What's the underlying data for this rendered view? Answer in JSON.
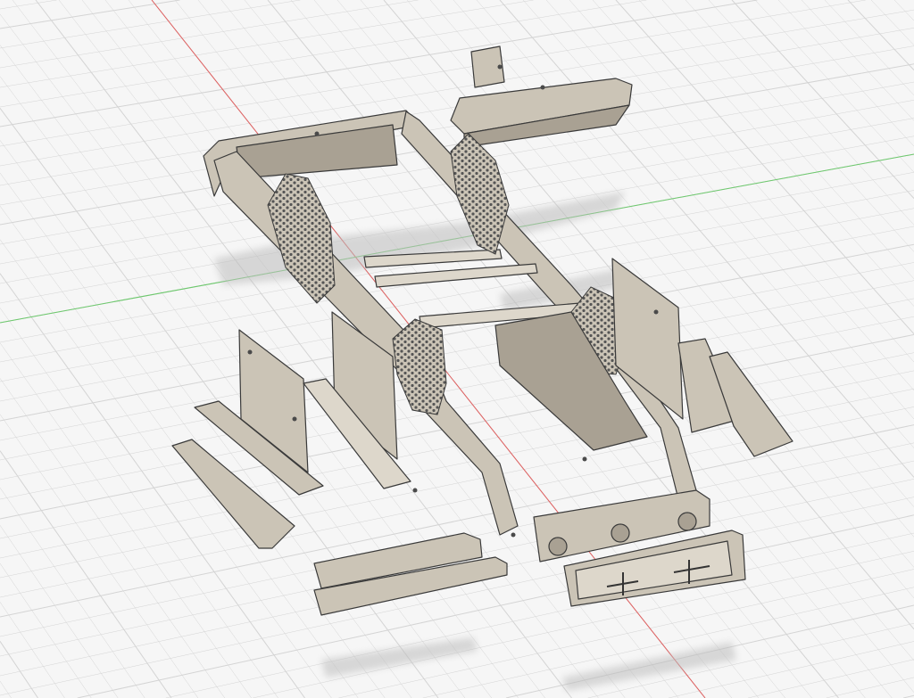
{
  "viewport": {
    "background_color": "#f6f6f6",
    "grid_color": "#d4d4d4",
    "x_axis_color": "#e06060",
    "y_axis_color": "#6cc96c",
    "model_color": "#cbc4b6",
    "edge_color": "#3a3a3a"
  },
  "model": {
    "icon": "rc-chassis-assembly-icon"
  }
}
